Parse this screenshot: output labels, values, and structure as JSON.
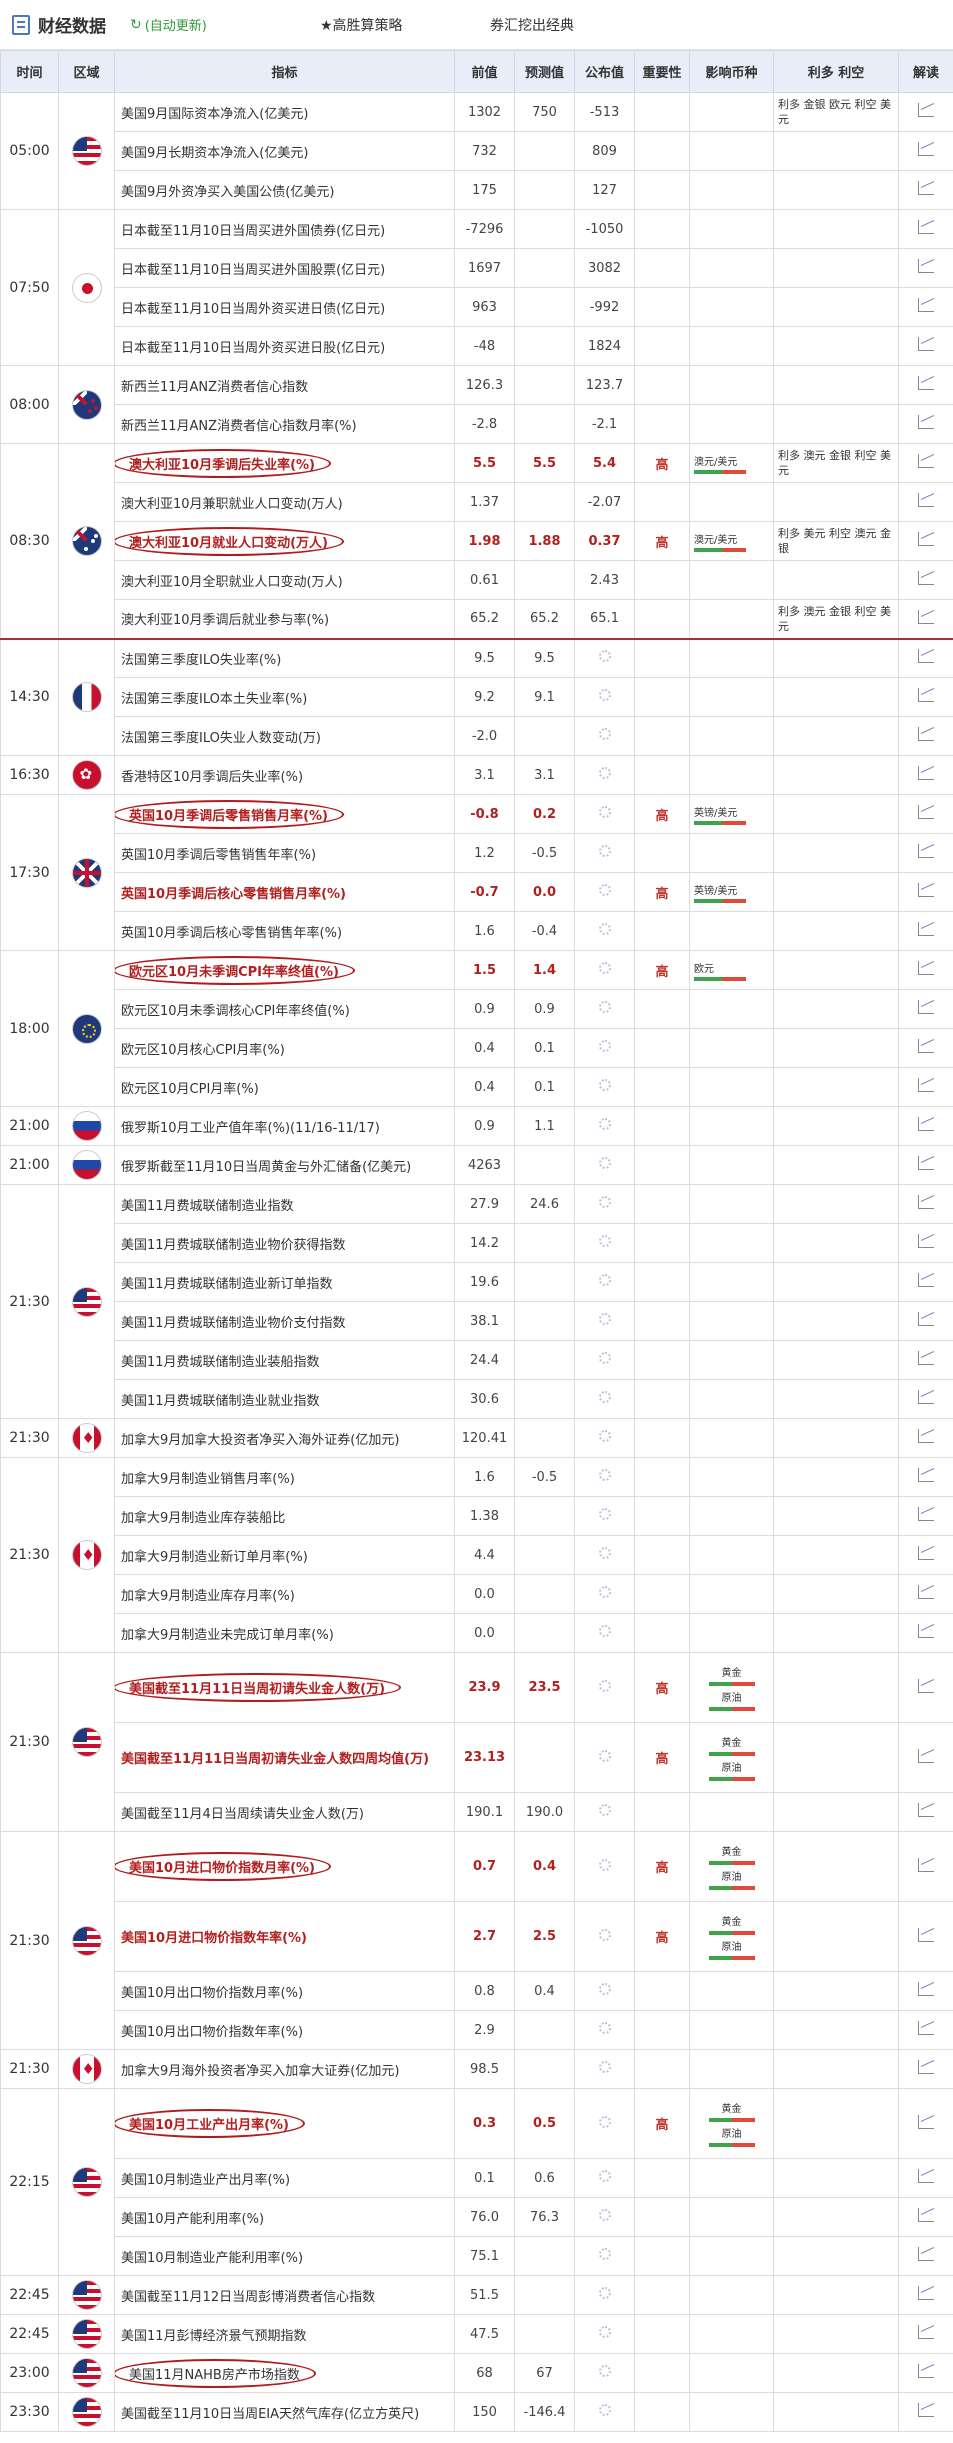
{
  "header": {
    "title": "财经数据",
    "auto_refresh": "(自动更新)",
    "strategy": "★高胜算策略",
    "classic": "券汇挖出经典"
  },
  "columns": [
    "时间",
    "区域",
    "指标",
    "前值",
    "预测值",
    "公布值",
    "重要性",
    "影响币种",
    "利多 利空",
    "解读"
  ],
  "rows": [
    {
      "time": "05:00",
      "rowspan": 3,
      "flag": "us",
      "flag_icon": "us-flag-icon",
      "indicator": "美国9月国际资本净流入(亿美元)",
      "prev": "1302",
      "fcst": "750",
      "actual": "-513",
      "ls": "利多 金银 欧元 利空 美元"
    },
    {
      "indicator": "美国9月长期资本净流入(亿美元)",
      "prev": "732",
      "fcst": "",
      "actual": "809"
    },
    {
      "indicator": "美国9月外资净买入美国公债(亿美元)",
      "prev": "175",
      "fcst": "",
      "actual": "127"
    },
    {
      "time": "07:50",
      "rowspan": 4,
      "flag": "jp",
      "flag_icon": "japan-flag-icon",
      "indicator": "日本截至11月10日当周买进外国债券(亿日元)",
      "prev": "-7296",
      "fcst": "",
      "actual": "-1050"
    },
    {
      "indicator": "日本截至11月10日当周买进外国股票(亿日元)",
      "prev": "1697",
      "fcst": "",
      "actual": "3082"
    },
    {
      "indicator": "日本截至11月10日当周外资买进日债(亿日元)",
      "prev": "963",
      "fcst": "",
      "actual": "-992"
    },
    {
      "indicator": "日本截至11月10日当周外资买进日股(亿日元)",
      "prev": "-48",
      "fcst": "",
      "actual": "1824"
    },
    {
      "time": "08:00",
      "rowspan": 2,
      "flag": "nz",
      "flag_icon": "new-zealand-flag-icon",
      "indicator": "新西兰11月ANZ消费者信心指数",
      "prev": "126.3",
      "fcst": "",
      "actual": "123.7"
    },
    {
      "indicator": "新西兰11月ANZ消费者信心指数月率(%)",
      "prev": "-2.8",
      "fcst": "",
      "actual": "-2.1"
    },
    {
      "time": "08:30",
      "rowspan": 5,
      "flag": "au",
      "flag_icon": "australia-flag-icon",
      "indicator": "澳大利亚10月季调后失业率(%)",
      "prev": "5.5",
      "fcst": "5.5",
      "actual": "5.4",
      "important": true,
      "imp": "高",
      "curr": "澳元/美元",
      "ls": "利多 澳元 金银 利空 美元"
    },
    {
      "indicator": "澳大利亚10月兼职就业人口变动(万人)",
      "prev": "1.37",
      "fcst": "",
      "actual": "-2.07"
    },
    {
      "indicator": "澳大利亚10月就业人口变动(万人)",
      "prev": "1.98",
      "fcst": "1.88",
      "actual": "0.37",
      "important": true,
      "imp": "高",
      "curr": "澳元/美元",
      "ls": "利多 美元 利空 澳元 金银"
    },
    {
      "indicator": "澳大利亚10月全职就业人口变动(万人)",
      "prev": "0.61",
      "fcst": "",
      "actual": "2.43"
    },
    {
      "indicator": "澳大利亚10月季调后就业参与率(%)",
      "prev": "65.2",
      "fcst": "65.2",
      "actual": "65.1",
      "ls": "利多 澳元 金银 利空 美元"
    },
    {
      "time": "14:30",
      "rowspan": 3,
      "flag": "fr",
      "flag_icon": "france-flag-icon",
      "sep": true,
      "indicator": "法国第三季度ILO失业率(%)",
      "prev": "9.5",
      "fcst": "9.5",
      "actual": "",
      "pending": true
    },
    {
      "indicator": "法国第三季度ILO本土失业率(%)",
      "prev": "9.2",
      "fcst": "9.1",
      "actual": "",
      "pending": true
    },
    {
      "indicator": "法国第三季度ILO失业人数变动(万)",
      "prev": "-2.0",
      "fcst": "",
      "actual": "",
      "pending": true
    },
    {
      "time": "16:30",
      "rowspan": 1,
      "flag": "hk",
      "flag_icon": "hong-kong-flag-icon",
      "indicator": "香港特区10月季调后失业率(%)",
      "prev": "3.1",
      "fcst": "3.1",
      "actual": "",
      "pending": true
    },
    {
      "time": "17:30",
      "rowspan": 4,
      "flag": "uk",
      "flag_icon": "uk-flag-icon",
      "indicator": "英国10月季调后零售销售月率(%)",
      "prev": "-0.8",
      "fcst": "0.2",
      "actual": "",
      "pending": true,
      "important": true,
      "imp": "高",
      "curr": "英镑/美元"
    },
    {
      "indicator": "英国10月季调后零售销售年率(%)",
      "prev": "1.2",
      "fcst": "-0.5",
      "actual": "",
      "pending": true
    },
    {
      "indicator": "英国10月季调后核心零售销售月率(%)",
      "prev": "-0.7",
      "fcst": "0.0",
      "actual": "",
      "pending": true,
      "important": true,
      "imp": "高",
      "curr": "英镑/美元",
      "nooval": true
    },
    {
      "indicator": "英国10月季调后核心零售销售年率(%)",
      "prev": "1.6",
      "fcst": "-0.4",
      "actual": "",
      "pending": true
    },
    {
      "time": "18:00",
      "rowspan": 4,
      "flag": "eu",
      "flag_icon": "eu-flag-icon",
      "indicator": "欧元区10月未季调CPI年率终值(%)",
      "prev": "1.5",
      "fcst": "1.4",
      "actual": "",
      "pending": true,
      "important": true,
      "imp": "高",
      "curr": "欧元"
    },
    {
      "indicator": "欧元区10月未季调核心CPI年率终值(%)",
      "prev": "0.9",
      "fcst": "0.9",
      "actual": "",
      "pending": true
    },
    {
      "indicator": "欧元区10月核心CPI月率(%)",
      "prev": "0.4",
      "fcst": "0.1",
      "actual": "",
      "pending": true
    },
    {
      "indicator": "欧元区10月CPI月率(%)",
      "prev": "0.4",
      "fcst": "0.1",
      "actual": "",
      "pending": true
    },
    {
      "time": "21:00",
      "rowspan": 1,
      "flag": "ru",
      "flag_icon": "russia-flag-icon",
      "indicator": "俄罗斯10月工业产值年率(%)(11/16-11/17)",
      "prev": "0.9",
      "fcst": "1.1",
      "actual": "",
      "pending": true
    },
    {
      "time": "21:00",
      "rowspan": 1,
      "flag": "ru",
      "flag_icon": "russia-flag-icon",
      "indicator": "俄罗斯截至11月10日当周黄金与外汇储备(亿美元)",
      "prev": "4263",
      "fcst": "",
      "actual": "",
      "pending": true
    },
    {
      "time": "21:30",
      "rowspan": 6,
      "flag": "us",
      "flag_icon": "us-flag-icon",
      "indicator": "美国11月费城联储制造业指数",
      "prev": "27.9",
      "fcst": "24.6",
      "actual": "",
      "pending": true
    },
    {
      "indicator": "美国11月费城联储制造业物价获得指数",
      "prev": "14.2",
      "fcst": "",
      "actual": "",
      "pending": true
    },
    {
      "indicator": "美国11月费城联储制造业新订单指数",
      "prev": "19.6",
      "fcst": "",
      "actual": "",
      "pending": true
    },
    {
      "indicator": "美国11月费城联储制造业物价支付指数",
      "prev": "38.1",
      "fcst": "",
      "actual": "",
      "pending": true
    },
    {
      "indicator": "美国11月费城联储制造业装船指数",
      "prev": "24.4",
      "fcst": "",
      "actual": "",
      "pending": true
    },
    {
      "indicator": "美国11月费城联储制造业就业指数",
      "prev": "30.6",
      "fcst": "",
      "actual": "",
      "pending": true
    },
    {
      "time": "21:30",
      "rowspan": 1,
      "flag": "ca",
      "flag_icon": "canada-flag-icon",
      "indicator": "加拿大9月加拿大投资者净买入海外证券(亿加元)",
      "prev": "120.41",
      "fcst": "",
      "actual": "",
      "pending": true
    },
    {
      "time": "21:30",
      "rowspan": 5,
      "flag": "ca",
      "flag_icon": "canada-flag-icon",
      "indicator": "加拿大9月制造业销售月率(%)",
      "prev": "1.6",
      "fcst": "-0.5",
      "actual": "",
      "pending": true
    },
    {
      "indicator": "加拿大9月制造业库存装船比",
      "prev": "1.38",
      "fcst": "",
      "actual": "",
      "pending": true
    },
    {
      "indicator": "加拿大9月制造业新订单月率(%)",
      "prev": "4.4",
      "fcst": "",
      "actual": "",
      "pending": true
    },
    {
      "indicator": "加拿大9月制造业库存月率(%)",
      "prev": "0.0",
      "fcst": "",
      "actual": "",
      "pending": true
    },
    {
      "indicator": "加拿大9月制造业未完成订单月率(%)",
      "prev": "0.0",
      "fcst": "",
      "actual": "",
      "pending": true
    },
    {
      "time": "21:30",
      "rowspan": 3,
      "flag": "us",
      "flag_icon": "us-flag-icon",
      "indicator": "美国截至11月11日当周初请失业金人数(万)",
      "prev": "23.9",
      "fcst": "23.5",
      "actual": "",
      "pending": true,
      "important": true,
      "imp": "高",
      "stack": [
        "黄金",
        "原油"
      ],
      "tall": true
    },
    {
      "indicator": "美国截至11月11日当周初请失业金人数四周均值(万)",
      "prev": "23.13",
      "fcst": "",
      "actual": "",
      "pending": true,
      "important": true,
      "imp": "高",
      "stack": [
        "黄金",
        "原油"
      ],
      "tall": true,
      "nooval": true
    },
    {
      "indicator": "美国截至11月4日当周续请失业金人数(万)",
      "prev": "190.1",
      "fcst": "190.0",
      "actual": "",
      "pending": true
    },
    {
      "time": "21:30",
      "rowspan": 4,
      "flag": "us",
      "flag_icon": "us-flag-icon",
      "indicator": "美国10月进口物价指数月率(%)",
      "prev": "0.7",
      "fcst": "0.4",
      "actual": "",
      "pending": true,
      "important": true,
      "imp": "高",
      "stack": [
        "黄金",
        "原油"
      ],
      "tall": true
    },
    {
      "indicator": "美国10月进口物价指数年率(%)",
      "prev": "2.7",
      "fcst": "2.5",
      "actual": "",
      "pending": true,
      "important": true,
      "imp": "高",
      "stack": [
        "黄金",
        "原油"
      ],
      "tall": true,
      "nooval": true
    },
    {
      "indicator": "美国10月出口物价指数月率(%)",
      "prev": "0.8",
      "fcst": "0.4",
      "actual": "",
      "pending": true
    },
    {
      "indicator": "美国10月出口物价指数年率(%)",
      "prev": "2.9",
      "fcst": "",
      "actual": "",
      "pending": true
    },
    {
      "time": "21:30",
      "rowspan": 1,
      "flag": "ca",
      "flag_icon": "canada-flag-icon",
      "indicator": "加拿大9月海外投资者净买入加拿大证券(亿加元)",
      "prev": "98.5",
      "fcst": "",
      "actual": "",
      "pending": true
    },
    {
      "time": "22:15",
      "rowspan": 4,
      "flag": "us",
      "flag_icon": "us-flag-icon",
      "indicator": "美国10月工业产出月率(%)",
      "prev": "0.3",
      "fcst": "0.5",
      "actual": "",
      "pending": true,
      "important": true,
      "imp": "高",
      "stack": [
        "黄金",
        "原油"
      ],
      "tall": true
    },
    {
      "indicator": "美国10月制造业产出月率(%)",
      "prev": "0.1",
      "fcst": "0.6",
      "actual": "",
      "pending": true
    },
    {
      "indicator": "美国10月产能利用率(%)",
      "prev": "76.0",
      "fcst": "76.3",
      "actual": "",
      "pending": true
    },
    {
      "indicator": "美国10月制造业产能利用率(%)",
      "prev": "75.1",
      "fcst": "",
      "actual": "",
      "pending": true
    },
    {
      "time": "22:45",
      "rowspan": 1,
      "flag": "us",
      "flag_icon": "us-flag-icon",
      "indicator": "美国截至11月12日当周彭博消费者信心指数",
      "prev": "51.5",
      "fcst": "",
      "actual": "",
      "pending": true
    },
    {
      "time": "22:45",
      "rowspan": 1,
      "flag": "us",
      "flag_icon": "us-flag-icon",
      "indicator": "美国11月彭博经济景气预期指数",
      "prev": "47.5",
      "fcst": "",
      "actual": "",
      "pending": true
    },
    {
      "time": "23:00",
      "rowspan": 1,
      "flag": "us",
      "flag_icon": "us-flag-icon",
      "indicator": "美国11月NAHB房产市场指数",
      "prev": "68",
      "fcst": "67",
      "actual": "",
      "pending": true,
      "oval_plain": true
    },
    {
      "time": "23:30",
      "rowspan": 1,
      "flag": "us",
      "flag_icon": "us-flag-icon",
      "indicator": "美国截至11月10日当周EIA天然气库存(亿立方英尺)",
      "prev": "150",
      "fcst": "-146.4",
      "actual": "",
      "pending": true
    }
  ]
}
